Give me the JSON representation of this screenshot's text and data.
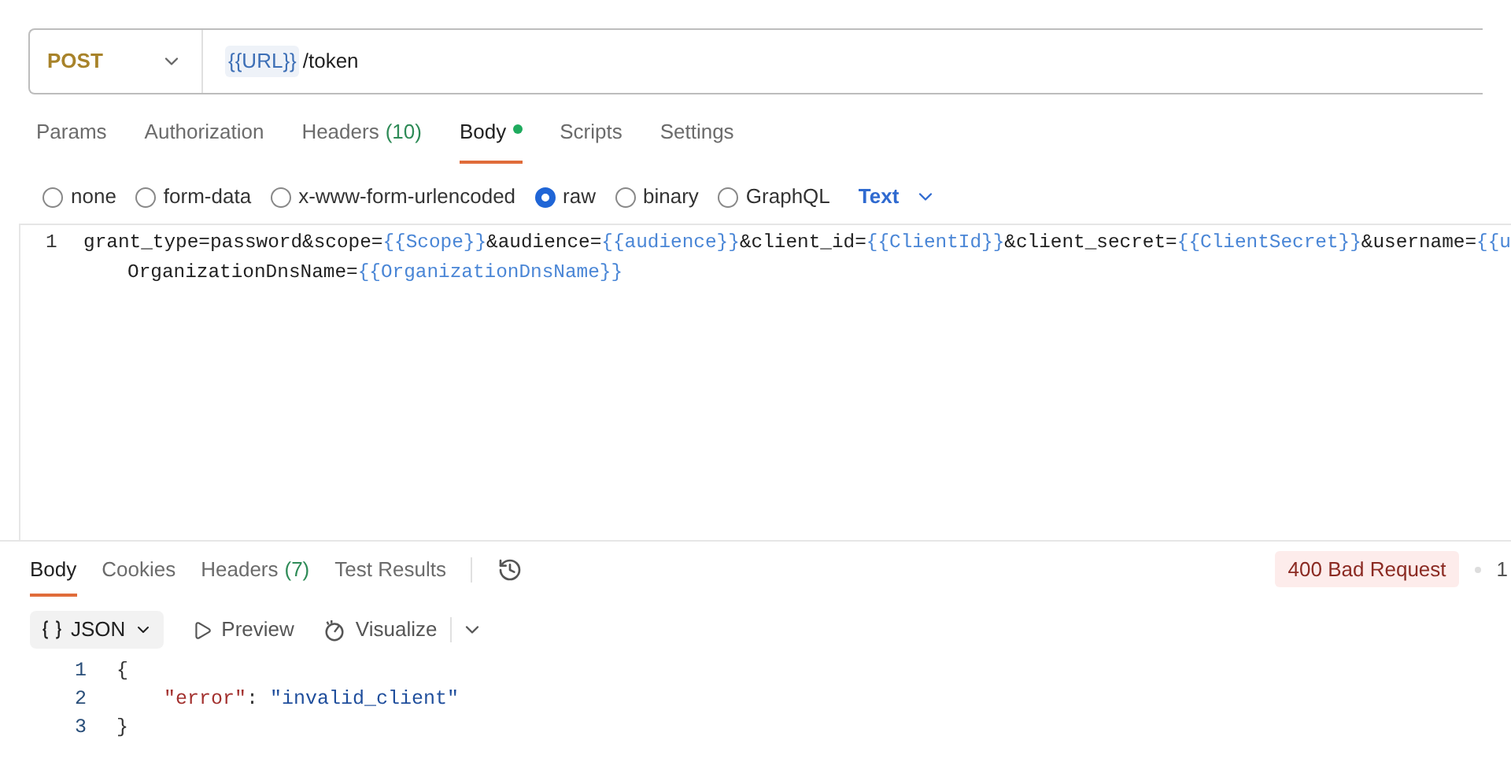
{
  "request": {
    "method": "POST",
    "url_variable": "{{URL}}",
    "url_path": "/token"
  },
  "request_tabs": [
    {
      "label": "Params",
      "selected": false,
      "dot": false
    },
    {
      "label": "Authorization",
      "selected": false,
      "dot": false
    },
    {
      "label": "Headers",
      "count": "(10)",
      "selected": false,
      "dot": false
    },
    {
      "label": "Body",
      "selected": true,
      "dot": true
    },
    {
      "label": "Scripts",
      "selected": false,
      "dot": false
    },
    {
      "label": "Settings",
      "selected": false,
      "dot": false
    }
  ],
  "body_types": [
    {
      "label": "none",
      "selected": false
    },
    {
      "label": "form-data",
      "selected": false
    },
    {
      "label": "x-www-form-urlencoded",
      "selected": false
    },
    {
      "label": "raw",
      "selected": true
    },
    {
      "label": "binary",
      "selected": false
    },
    {
      "label": "GraphQL",
      "selected": false
    }
  ],
  "raw_format": "Text",
  "editor": {
    "line_number": "1",
    "lines": [
      [
        {
          "kind": "text",
          "text": "grant_type=password&scope="
        },
        {
          "kind": "var",
          "text": "{{Scope}}"
        },
        {
          "kind": "text",
          "text": "&audience="
        },
        {
          "kind": "var",
          "text": "{{audience}}"
        },
        {
          "kind": "text",
          "text": "&client_id="
        },
        {
          "kind": "var",
          "text": "{{ClientId}}"
        },
        {
          "kind": "text",
          "text": "&client_secret="
        },
        {
          "kind": "var",
          "text": "{{ClientSecret}}"
        },
        {
          "kind": "text",
          "text": "&username="
        },
        {
          "kind": "var",
          "text": "{{u"
        }
      ],
      [
        {
          "kind": "text",
          "text": "OrganizationDnsName="
        },
        {
          "kind": "var",
          "text": "{{OrganizationDnsName}}"
        }
      ]
    ]
  },
  "response_tabs": [
    {
      "label": "Body",
      "selected": true
    },
    {
      "label": "Cookies",
      "selected": false
    },
    {
      "label": "Headers",
      "count": "(7)",
      "selected": false
    },
    {
      "label": "Test Results",
      "selected": false
    }
  ],
  "status": "400 Bad Request",
  "status_meta": "1",
  "response_toolbar": {
    "format": "JSON",
    "preview": "Preview",
    "visualize": "Visualize"
  },
  "response_lines": [
    {
      "number": "1",
      "tokens": [
        {
          "kind": "punct",
          "text": "{"
        }
      ]
    },
    {
      "number": "2",
      "tokens": [
        {
          "kind": "key",
          "text": "\"error\""
        },
        {
          "kind": "punct",
          "text": ": "
        },
        {
          "kind": "string",
          "text": "\"invalid_client\""
        }
      ]
    },
    {
      "number": "3",
      "tokens": [
        {
          "kind": "punct",
          "text": "}"
        }
      ]
    }
  ]
}
